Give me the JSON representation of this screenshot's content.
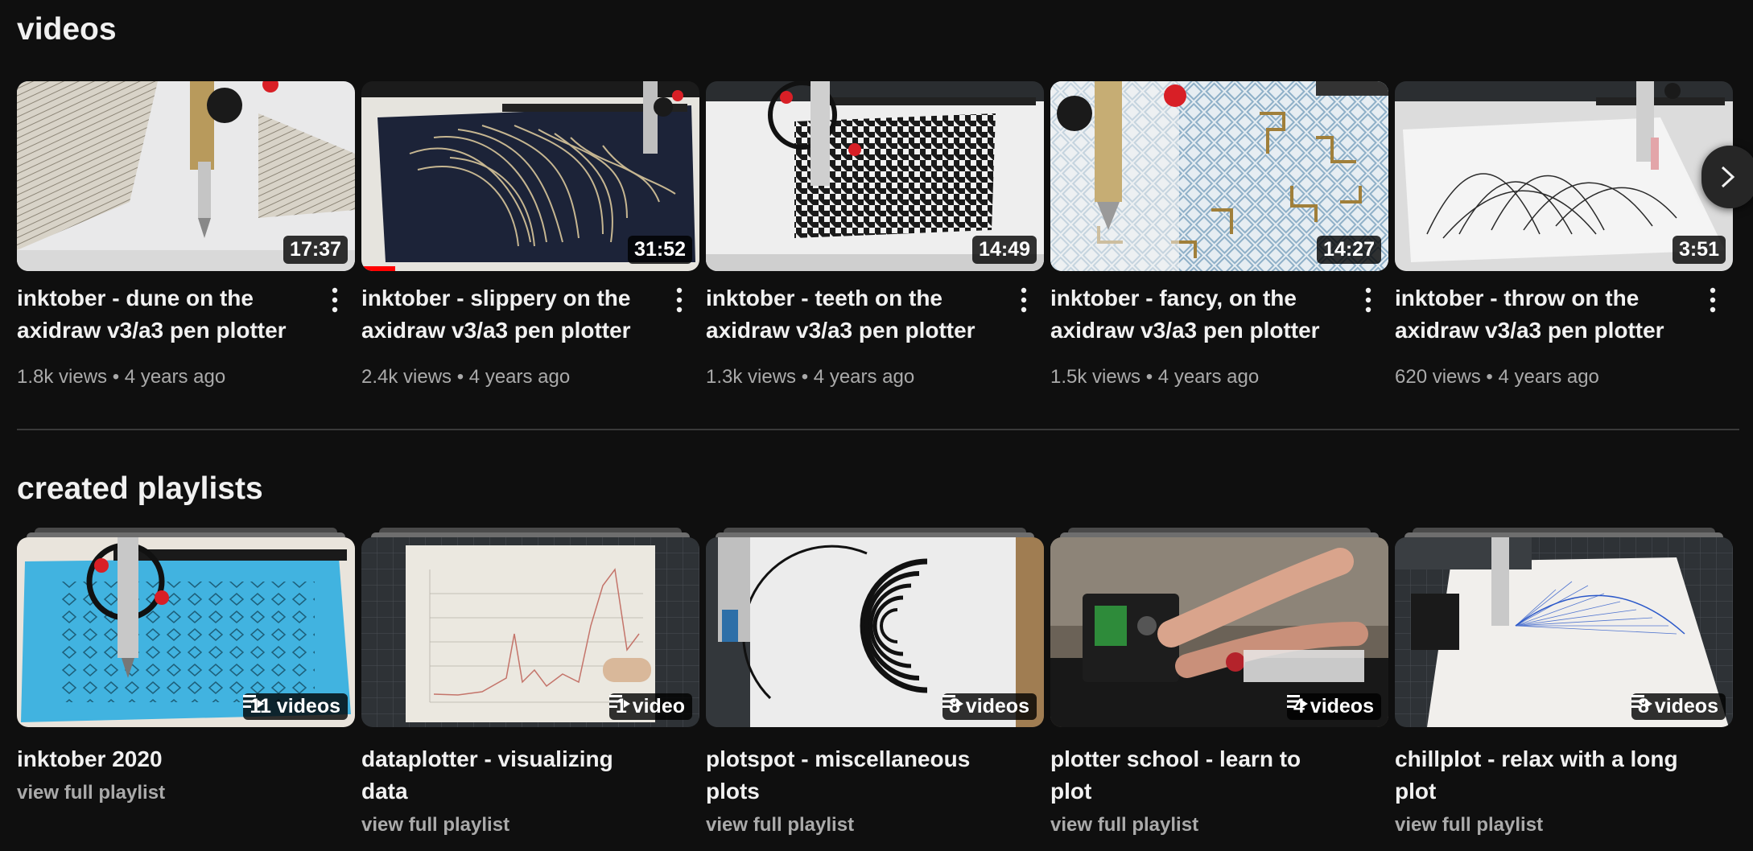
{
  "videos_section": {
    "title": "videos",
    "items": [
      {
        "title": "inktober - dune on the axidraw v3/a3 pen plotter",
        "duration": "17:37",
        "views": "1.8k views",
        "age": "4 years ago",
        "thumbnail": "hatched dune drawing under pen plotter",
        "watch_progress": 0
      },
      {
        "title": "inktober - slippery on the axidraw v3/a3 pen plotter",
        "duration": "31:52",
        "views": "2.4k views",
        "age": "4 years ago",
        "thumbnail": "flowing gold lines on navy paper",
        "watch_progress": 0.1
      },
      {
        "title": "inktober - teeth on the axidraw v3/a3 pen plotter",
        "duration": "14:49",
        "views": "1.3k views",
        "age": "4 years ago",
        "thumbnail": "houndstooth pattern drawing",
        "watch_progress": 0
      },
      {
        "title": "inktober - fancy, on the axidraw v3/a3 pen plotter",
        "duration": "14:27",
        "views": "1.5k views",
        "age": "4 years ago",
        "thumbnail": "lattice maze pattern",
        "watch_progress": 0
      },
      {
        "title": "inktober - throw on the axidraw v3/a3 pen plotter",
        "duration": "3:51",
        "views": "620 views",
        "age": "4 years ago",
        "thumbnail": "arcs drawn on white paper",
        "watch_progress": 0
      }
    ],
    "meta_separator": "•",
    "next_icon": "chevron-right-icon",
    "menu_icon": "vertical-dots-icon"
  },
  "playlists_section": {
    "title": "created playlists",
    "items": [
      {
        "title": "inktober 2020",
        "count": "11 videos",
        "link": "view full playlist",
        "thumbnail": "blue paper with diamond grid pattern"
      },
      {
        "title": "dataplotter - visualizing data",
        "count": "1 video",
        "link": "view full playlist",
        "thumbnail": "line chart plotted on paper"
      },
      {
        "title": "plotspot - miscellaneous plots",
        "count": "8 videos",
        "link": "view full playlist",
        "thumbnail": "spiral circle drawing"
      },
      {
        "title": "plotter school - learn to plot",
        "count": "4 videos",
        "link": "view full playlist",
        "thumbnail": "hands working on plotter electronics"
      },
      {
        "title": "chillplot - relax with a long plot",
        "count": "8 videos",
        "link": "view full playlist",
        "thumbnail": "blue fan of lines on white paper"
      }
    ],
    "playlist_icon": "playlist-icon"
  },
  "colors": {
    "background": "#0f0f0f",
    "text_primary": "#f1f1f1",
    "text_secondary": "#aaaaaa",
    "progress": "#ff0000"
  }
}
